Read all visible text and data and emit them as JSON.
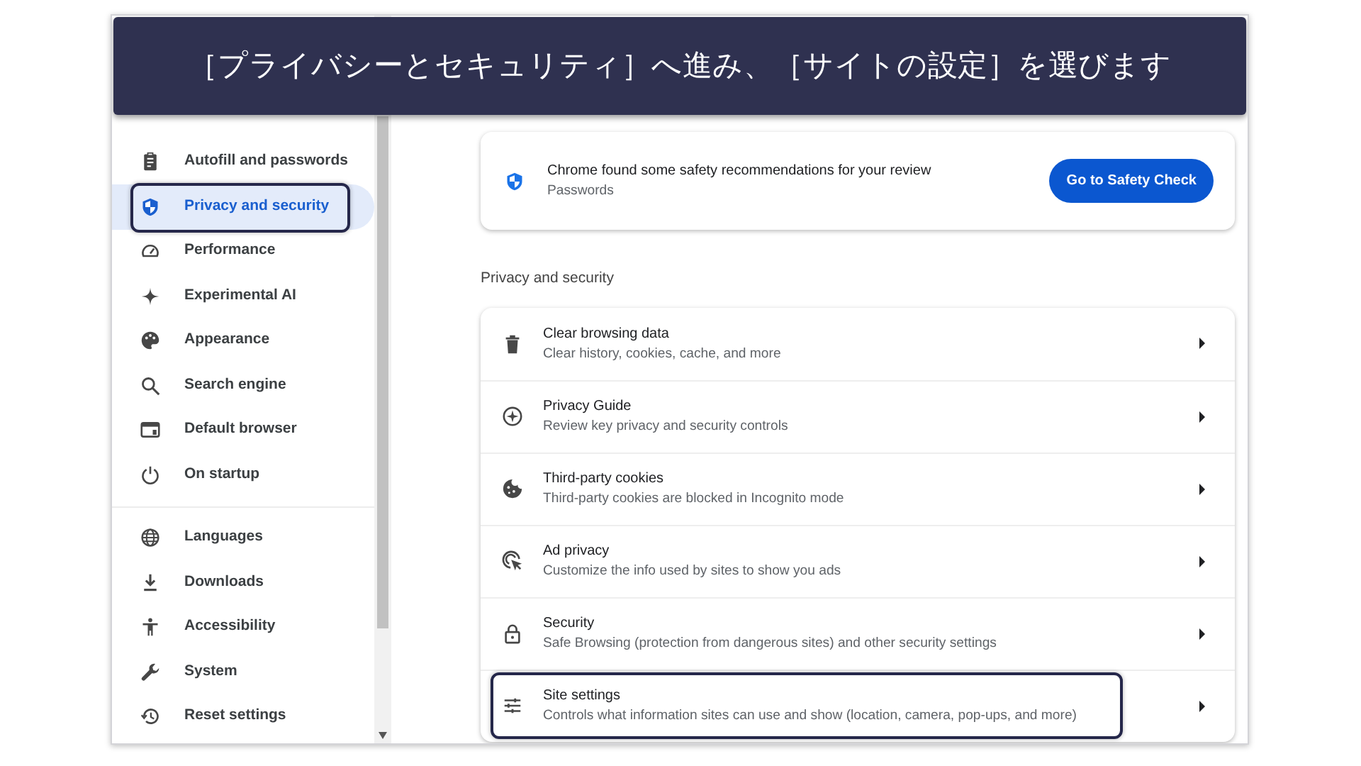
{
  "banner": {
    "text": "［プライバシーとセキュリティ］へ進み、［サイトの設定］を選びます"
  },
  "sidebar": {
    "items": [
      {
        "label": "Autofill and passwords",
        "selected": false,
        "highlighted": false
      },
      {
        "label": "Privacy and security",
        "selected": true,
        "highlighted": true
      },
      {
        "label": "Performance",
        "selected": false,
        "highlighted": false
      },
      {
        "label": "Experimental AI",
        "selected": false,
        "highlighted": false
      },
      {
        "label": "Appearance",
        "selected": false,
        "highlighted": false
      },
      {
        "label": "Search engine",
        "selected": false,
        "highlighted": false
      },
      {
        "label": "Default browser",
        "selected": false,
        "highlighted": false
      },
      {
        "label": "On startup",
        "selected": false,
        "highlighted": false
      },
      {
        "kind": "divider"
      },
      {
        "label": "Languages",
        "selected": false,
        "highlighted": false
      },
      {
        "label": "Downloads",
        "selected": false,
        "highlighted": false
      },
      {
        "label": "Accessibility",
        "selected": false,
        "highlighted": false
      },
      {
        "label": "System",
        "selected": false,
        "highlighted": false
      },
      {
        "label": "Reset settings",
        "selected": false,
        "highlighted": false
      }
    ]
  },
  "safety_card": {
    "title": "Chrome found some safety recommendations for your review",
    "subtitle": "Passwords",
    "button": "Go to Safety Check"
  },
  "section": {
    "heading": "Privacy and security",
    "rows": [
      {
        "title": "Clear browsing data",
        "subtitle": "Clear history, cookies, cache, and more",
        "highlighted": false
      },
      {
        "title": "Privacy Guide",
        "subtitle": "Review key privacy and security controls",
        "highlighted": false
      },
      {
        "title": "Third-party cookies",
        "subtitle": "Third-party cookies are blocked in Incognito mode",
        "highlighted": false
      },
      {
        "title": "Ad privacy",
        "subtitle": "Customize the info used by sites to show you ads",
        "highlighted": false
      },
      {
        "title": "Security",
        "subtitle": "Safe Browsing (protection from dangerous sites) and other security settings",
        "highlighted": false
      },
      {
        "title": "Site settings",
        "subtitle": "Controls what information sites can use and show (location, camera, pop-ups, and more)",
        "highlighted": true
      }
    ]
  }
}
